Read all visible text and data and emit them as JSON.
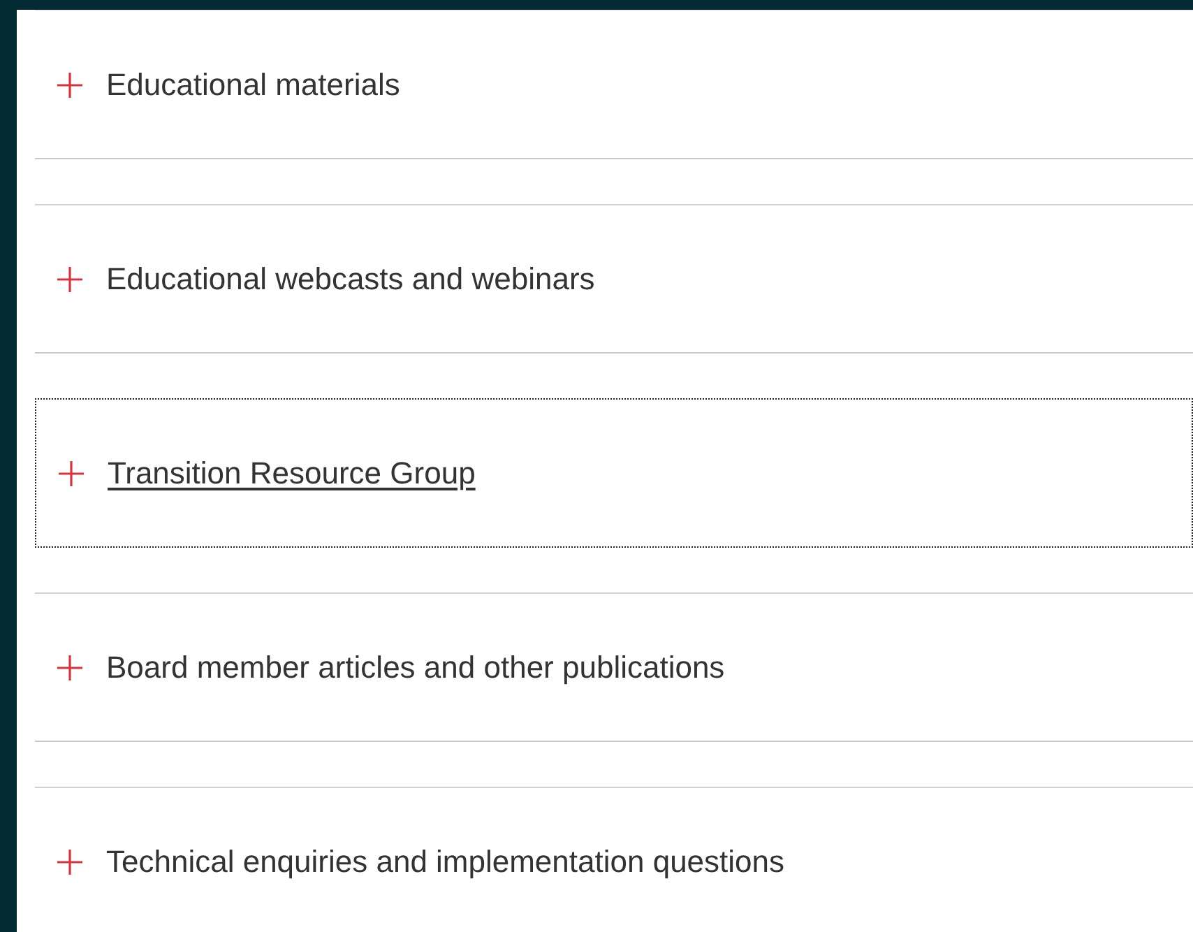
{
  "items": [
    {
      "label": "Educational materials",
      "expanded": false,
      "focused": false
    },
    {
      "label": "Educational webcasts and webinars",
      "expanded": false,
      "focused": false
    },
    {
      "label": "Transition Resource Group",
      "expanded": false,
      "focused": true
    },
    {
      "label": "Board member articles and other publications",
      "expanded": false,
      "focused": false
    },
    {
      "label": "Technical enquiries and implementation questions",
      "expanded": false,
      "focused": false
    }
  ]
}
